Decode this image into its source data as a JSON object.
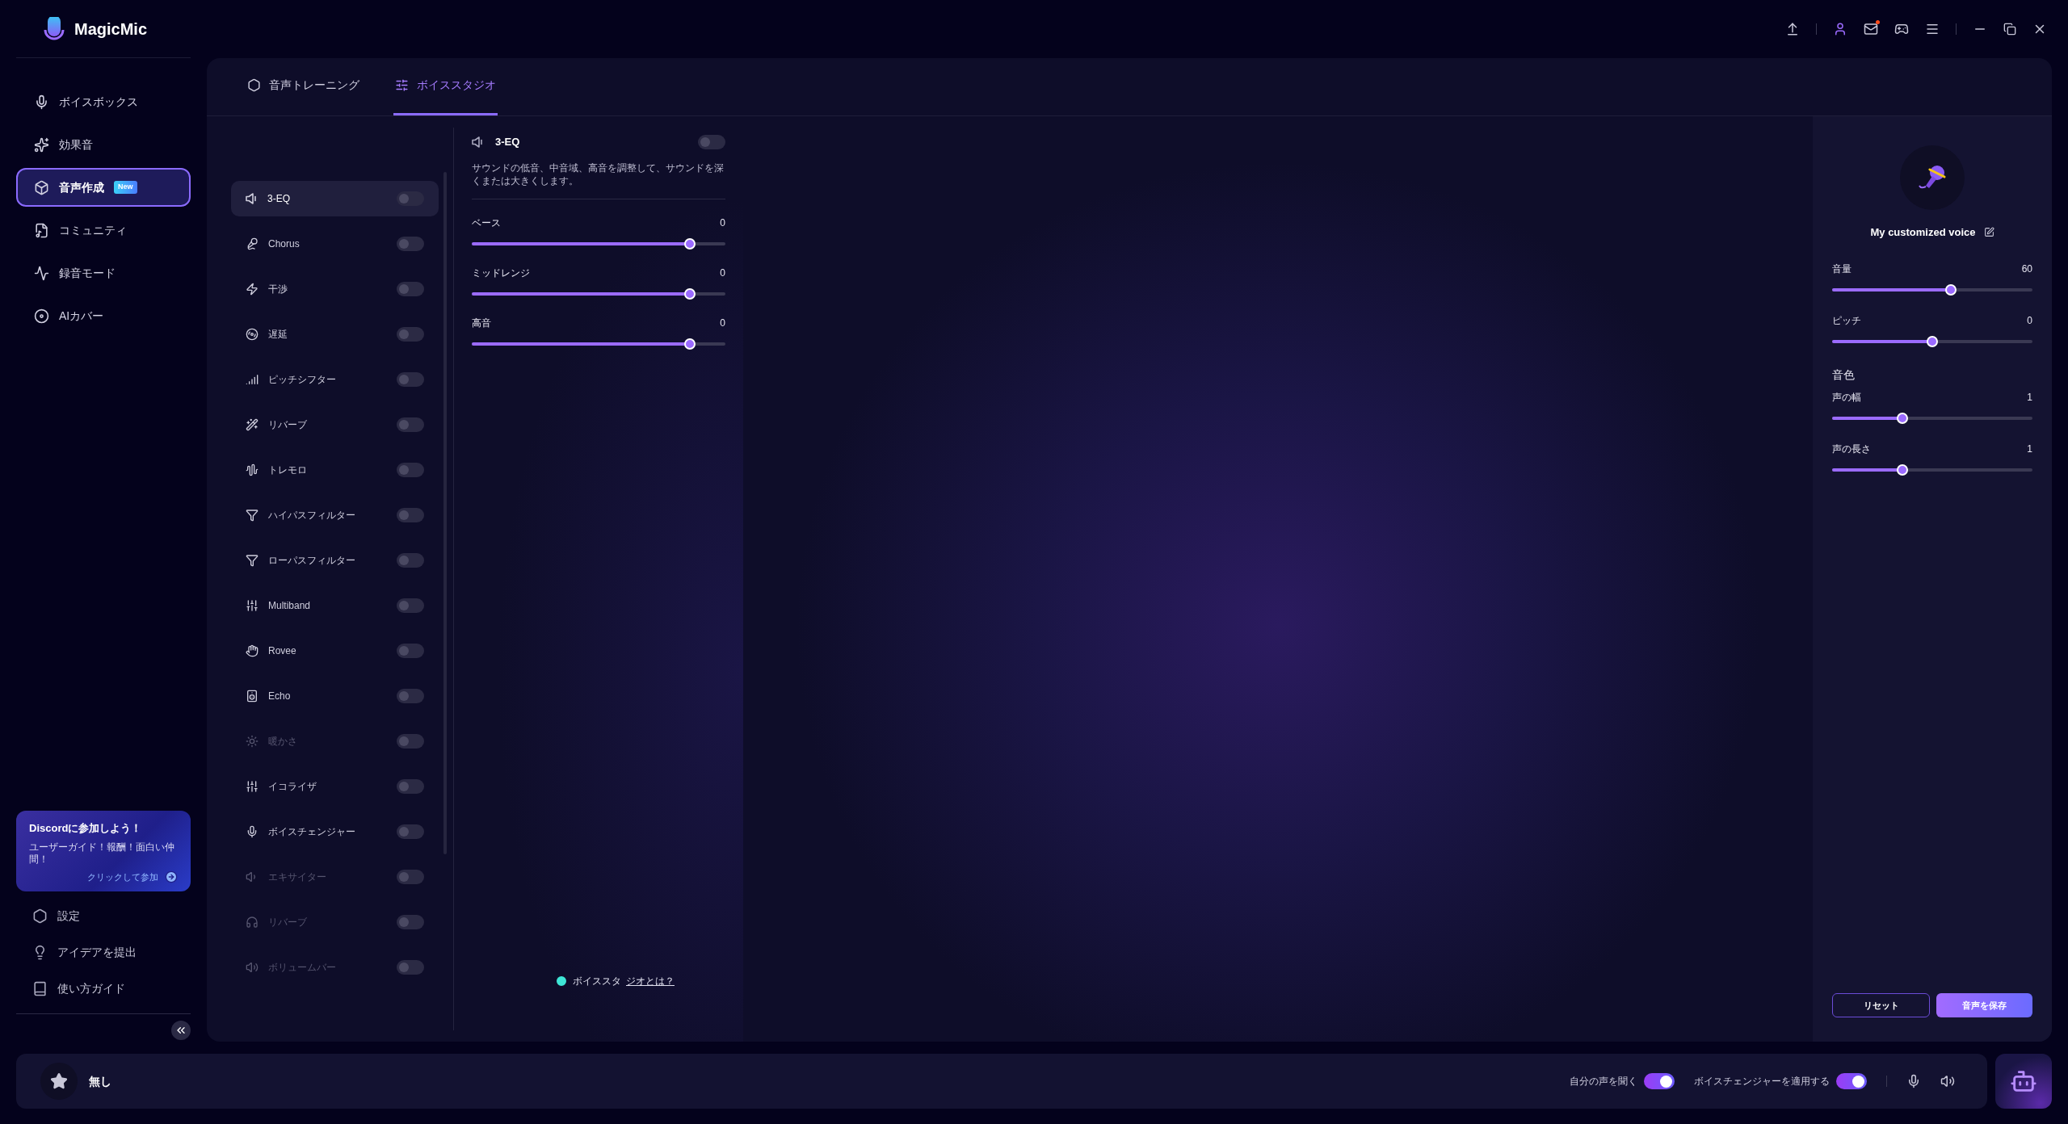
{
  "app": {
    "name": "MagicMic"
  },
  "top_bar": {
    "mail_unread": true
  },
  "sidebar": {
    "items": [
      {
        "label": "ボイスボックス",
        "selected": false
      },
      {
        "label": "効果音",
        "selected": false
      },
      {
        "label": "音声作成",
        "selected": true,
        "badge": "New"
      },
      {
        "label": "コミュニティ",
        "selected": false
      },
      {
        "label": "録音モード",
        "selected": false
      },
      {
        "label": "AIカバー",
        "selected": false
      }
    ],
    "promo": {
      "title": "Discordに参加しよう！",
      "text": "ユーザーガイド！報酬！面白い仲間！",
      "link": "クリックして参加"
    },
    "footer_items": [
      "設定",
      "アイデアを提出",
      "使い方ガイド"
    ]
  },
  "tabs": [
    {
      "label": "音声トレーニング",
      "selected": false
    },
    {
      "label": "ボイススタジオ",
      "selected": true
    }
  ],
  "effects": [
    {
      "label": "3-EQ",
      "selected": true,
      "on": false,
      "disabled": false
    },
    {
      "label": "Chorus",
      "selected": false,
      "on": false,
      "disabled": false
    },
    {
      "label": "干渉",
      "selected": false,
      "on": false,
      "disabled": false
    },
    {
      "label": "遅延",
      "selected": false,
      "on": false,
      "disabled": false
    },
    {
      "label": "ピッチシフター",
      "selected": false,
      "on": false,
      "disabled": false
    },
    {
      "label": "リバーブ",
      "selected": false,
      "on": false,
      "disabled": false
    },
    {
      "label": "トレモロ",
      "selected": false,
      "on": false,
      "disabled": false
    },
    {
      "label": "ハイパスフィルター",
      "selected": false,
      "on": false,
      "disabled": false
    },
    {
      "label": "ローパスフィルター",
      "selected": false,
      "on": false,
      "disabled": false
    },
    {
      "label": "Multiband",
      "selected": false,
      "on": false,
      "disabled": false
    },
    {
      "label": "Rovee",
      "selected": false,
      "on": false,
      "disabled": false
    },
    {
      "label": "Echo",
      "selected": false,
      "on": false,
      "disabled": false
    },
    {
      "label": "暖かさ",
      "selected": false,
      "on": false,
      "disabled": true
    },
    {
      "label": "イコライザ",
      "selected": false,
      "on": false,
      "disabled": false
    },
    {
      "label": "ボイスチェンジャー",
      "selected": false,
      "on": false,
      "disabled": false
    },
    {
      "label": "エキサイター",
      "selected": false,
      "on": false,
      "disabled": true
    },
    {
      "label": "リバーブ",
      "selected": false,
      "on": false,
      "disabled": true
    },
    {
      "label": "ボリュームバー",
      "selected": false,
      "on": false,
      "disabled": true
    }
  ],
  "effect_detail": {
    "title": "3-EQ",
    "on": false,
    "description": "サウンドの低音、中音域、高音を調整して、サウンドを深くまたは大きくします。",
    "sliders": [
      {
        "label": "ベース",
        "value": "0",
        "level": 0.875
      },
      {
        "label": "ミッドレンジ",
        "value": "0",
        "level": 0.875
      },
      {
        "label": "高音",
        "value": "0",
        "level": 0.875
      }
    ]
  },
  "help_link": {
    "text": "ボイススタ",
    "link": "ジオとは？"
  },
  "voice_panel": {
    "name": "My customized voice",
    "sliders": [
      {
        "label": "音量",
        "value": "60",
        "level": 0.6
      },
      {
        "label": "ピッチ",
        "value": "0",
        "level": 0.5
      }
    ],
    "timbre": {
      "heading": "音色",
      "sliders": [
        {
          "label": "声の幅",
          "value": "1",
          "level": 0.343
        },
        {
          "label": "声の長さ",
          "value": "1",
          "level": 0.343
        }
      ]
    },
    "reset_button": "リセット",
    "save_button": "音声を保存"
  },
  "bottom_bar": {
    "current_effect": "無し",
    "toggles": [
      {
        "label": "自分の声を聞く",
        "on": true
      },
      {
        "label": "ボイスチェンジャーを適用する",
        "on": true
      }
    ]
  }
}
